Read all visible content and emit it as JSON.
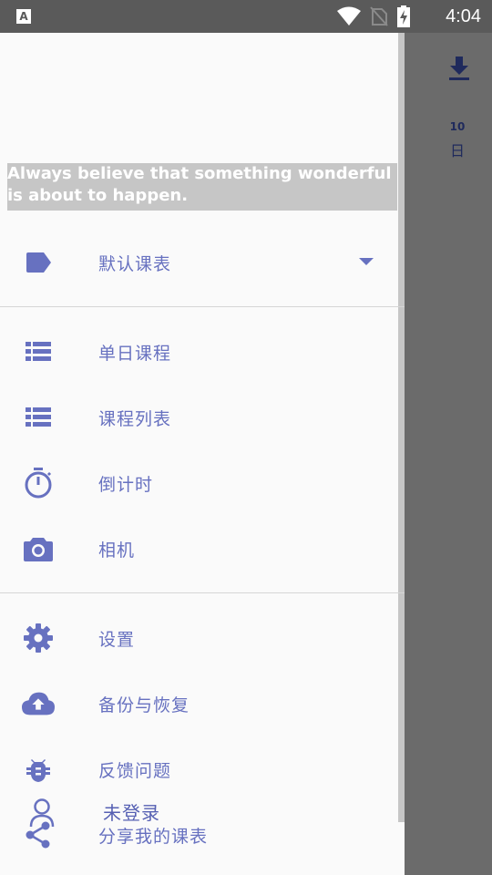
{
  "status_bar": {
    "app_icon_letter": "A",
    "time": "4:04"
  },
  "background": {
    "day_number": "10",
    "day_name": "日",
    "download_icon": "download-icon"
  },
  "drawer": {
    "quote": "Always believe that something wonderful is about to happen.",
    "schedule_selector": {
      "icon": "label-tag-icon",
      "label": "默认课表"
    },
    "menu_group_1": [
      {
        "icon": "list-icon",
        "label": "单日课程"
      },
      {
        "icon": "list-icon",
        "label": "课程列表"
      },
      {
        "icon": "timer-icon",
        "label": "倒计时"
      },
      {
        "icon": "camera-icon",
        "label": "相机"
      }
    ],
    "menu_group_2": [
      {
        "icon": "gear-icon",
        "label": "设置"
      },
      {
        "icon": "cloud-upload-icon",
        "label": "备份与恢复"
      },
      {
        "icon": "bug-icon",
        "label": "反馈问题"
      },
      {
        "icon": "share-icon",
        "label": "分享我的课表"
      }
    ],
    "login": {
      "icon": "person-icon",
      "label": "未登录"
    }
  },
  "colors": {
    "accent": "#6771c0",
    "scrim": "#6b6b6b",
    "status_bar": "#5a5a5a",
    "drawer_bg": "#fafafa"
  }
}
